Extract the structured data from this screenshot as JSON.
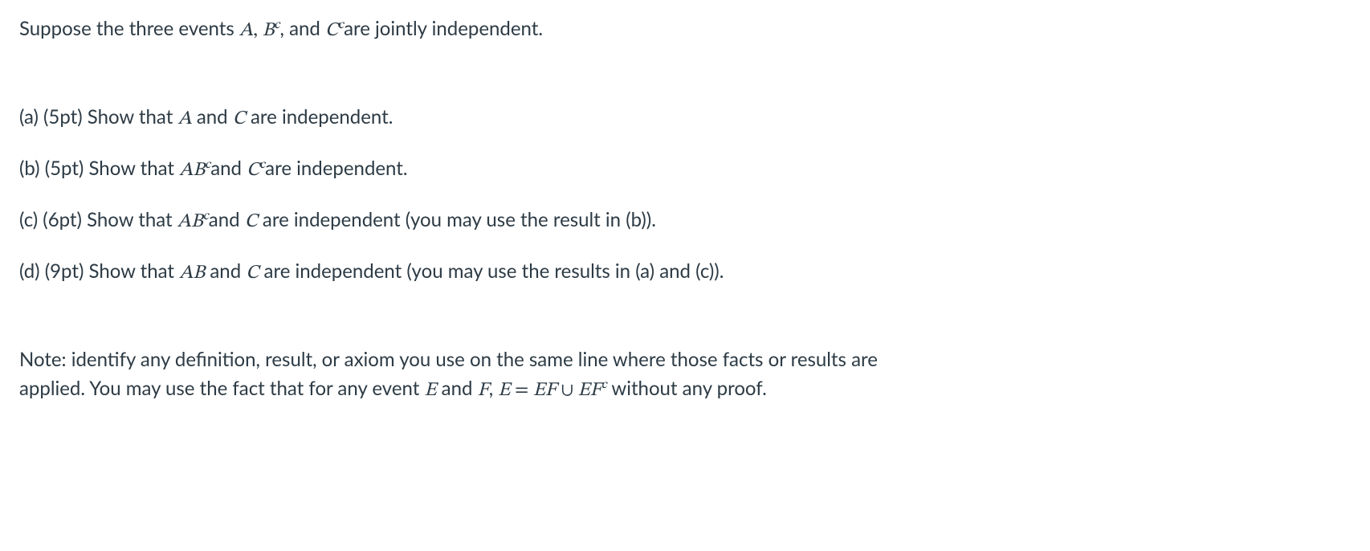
{
  "intro": {
    "pre": "Suppose the three events ",
    "expr1_A": "A",
    "expr1_comma": ", ",
    "expr1_B": "B",
    "expr1_sup": "c",
    "expr1_comma2": ", and ",
    "expr1_C": "C",
    "expr1_sup2": "c",
    "post": "are jointly independent."
  },
  "partA": {
    "label": "(a) (5pt) Show that ",
    "A": "A",
    "mid": " and ",
    "C": "C",
    "post": " are independent."
  },
  "partB": {
    "label": "(b) (5pt) Show that ",
    "AB": "AB",
    "sup1": "c",
    "mid": "and ",
    "C": "C",
    "sup2": "c",
    "post": "are independent."
  },
  "partC": {
    "label": "(c) (6pt) Show that ",
    "AB": "AB",
    "sup1": "c",
    "mid": "and ",
    "C": "C",
    "post": " are independent (you may use the result in (b))."
  },
  "partD": {
    "label": "(d) (9pt) Show that ",
    "AB": "AB",
    "mid": " and ",
    "C": "C",
    "post": " are independent (you may use the results in (a) and (c))."
  },
  "note": {
    "line1_pre": "Note: identify any definition, result, or axiom you use on the same line where those facts or results are",
    "line2_pre": "applied. You may use the fact that for any event ",
    "E": "E",
    "and": " and ",
    "F": "F",
    "comma": ", ",
    "E2": "E",
    "eq": " = ",
    "EF": "EF",
    "cup": " ∪ ",
    "EF2": "EF",
    "sup": "c",
    "post": " without any proof."
  }
}
